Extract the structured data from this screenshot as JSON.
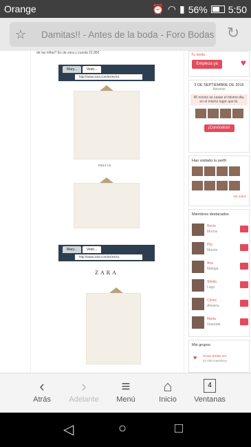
{
  "status": {
    "carrier": "Orange",
    "battery": "56%",
    "time": "5:50"
  },
  "browser": {
    "title": "Damitas!! - Antes de la boda - Foro Bodas",
    "screenshot_url": "http://www.zara.com/es/es/n1",
    "tab1": "Mary...",
    "tab2": "Vesti..."
  },
  "post": {
    "text": "de las niñas? Es de zara y cuesta 22,95€",
    "brand": "ZARA",
    "share": "Pinit f t G"
  },
  "sidebar": {
    "promo_line": "Tu boda",
    "promo_button": "Empieza ya",
    "date": "3 DE SEPTIEMBRE DE 2016",
    "place": "Asturias",
    "couples": "45 novios se casan el mismo día, en el mismo lugar que tú.",
    "couples_button": "¡Conócelos!",
    "visited_title": "Han visitado tu perfil",
    "see_all": "Ver todos",
    "featured_title": "Miembros destacados",
    "members": [
      {
        "name": "Rocío",
        "city": "Murcia"
      },
      {
        "name": "Pily",
        "city": "Murcia"
      },
      {
        "name": "Ana",
        "city": "Malaga"
      },
      {
        "name": "Sheila",
        "city": "Lugo"
      },
      {
        "name": "Crisss",
        "city": "Almería"
      },
      {
        "name": "Marta",
        "city": "Granada"
      }
    ],
    "groups_title": "Mis grupos",
    "group_name": "Grupo Bodas.net",
    "group_members": "21.038 miembros"
  },
  "toolbar": {
    "back": "Atrás",
    "forward": "Adelante",
    "menu": "Menú",
    "home": "Inicio",
    "tabs": "Ventanas",
    "tab_count": "4"
  }
}
